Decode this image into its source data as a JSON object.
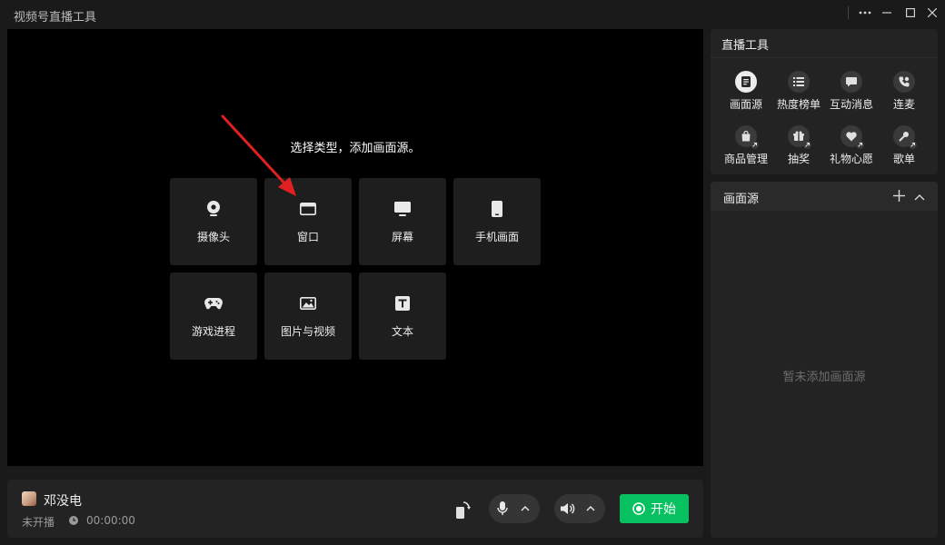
{
  "window": {
    "title": "视频号直播工具"
  },
  "preview": {
    "prompt": "选择类型，添加画面源。",
    "source_types": [
      {
        "label": "摄像头",
        "icon": "camera-icon"
      },
      {
        "label": "窗口",
        "icon": "window-icon"
      },
      {
        "label": "屏幕",
        "icon": "monitor-icon"
      },
      {
        "label": "手机画面",
        "icon": "phone-icon"
      },
      {
        "label": "游戏进程",
        "icon": "gamepad-icon"
      },
      {
        "label": "图片与视频",
        "icon": "image-icon"
      },
      {
        "label": "文本",
        "icon": "text-icon"
      }
    ]
  },
  "bottom": {
    "username": "邓没电",
    "status": "未开播",
    "timer": "00:00:00",
    "start_label": "开始"
  },
  "tools": {
    "title": "直播工具",
    "items": [
      {
        "label": "画面源",
        "icon": "source-icon",
        "active": true
      },
      {
        "label": "热度榜单",
        "icon": "list-icon"
      },
      {
        "label": "互动消息",
        "icon": "message-icon"
      },
      {
        "label": "连麦",
        "icon": "phone-call-icon"
      },
      {
        "label": "商品管理",
        "icon": "shopping-bag-icon"
      },
      {
        "label": "抽奖",
        "icon": "gift-box-icon"
      },
      {
        "label": "礼物心愿",
        "icon": "heart-gift-icon"
      },
      {
        "label": "歌单",
        "icon": "microphone-icon"
      }
    ]
  },
  "sources": {
    "title": "画面源",
    "empty_text": "暂未添加画面源"
  },
  "colors": {
    "accent": "#07c160",
    "arrow": "#e02020",
    "background": "#1a1a1a",
    "panel": "#232323"
  }
}
